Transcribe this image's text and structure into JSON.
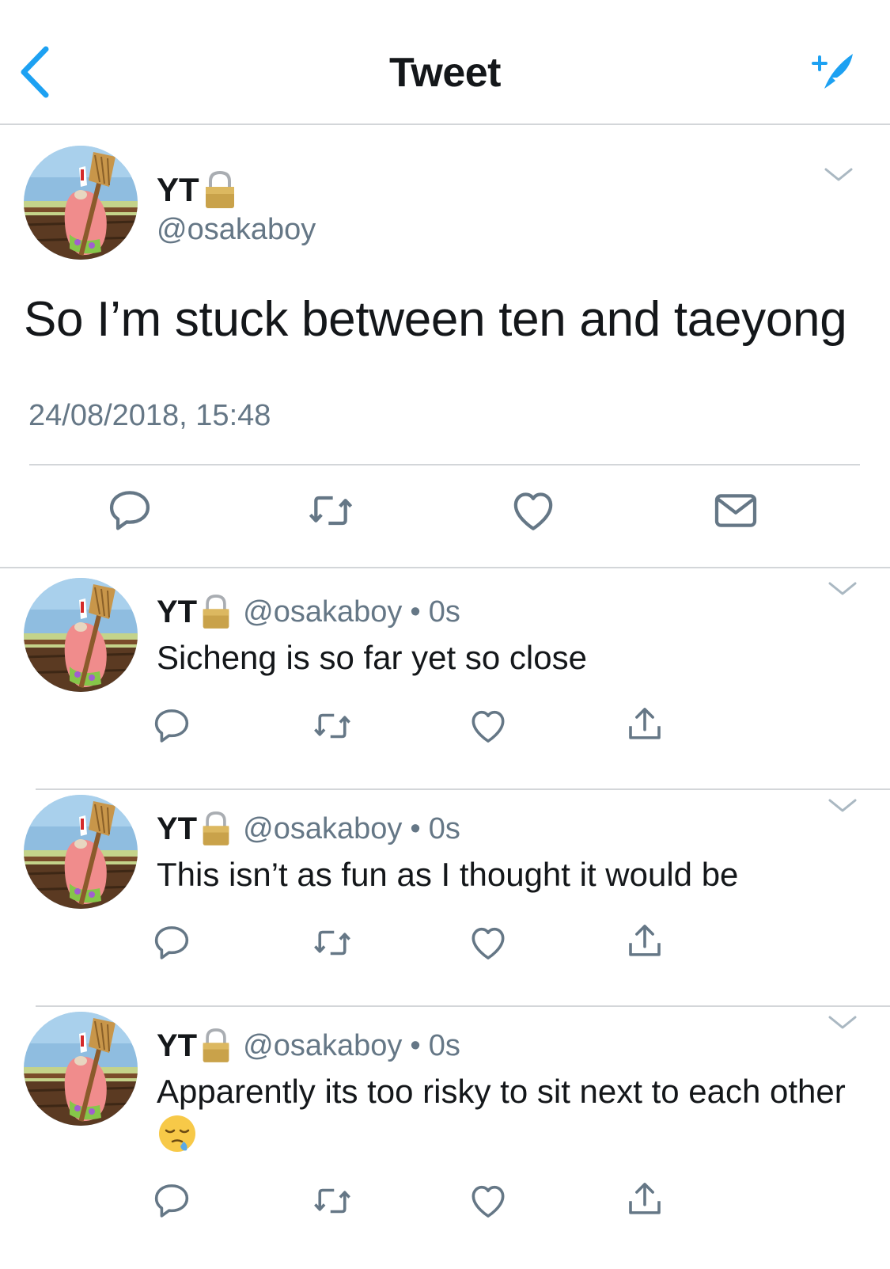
{
  "header": {
    "title": "Tweet",
    "back_icon": "chevron-left-icon",
    "compose_icon": "compose-feather-icon",
    "accent_color": "#1da1f2"
  },
  "main_tweet": {
    "name": "YT",
    "handle": "@osakaboy",
    "text": "So I’m stuck between ten and taeyong",
    "timestamp": "24/08/2018, 15:48",
    "actions": [
      "reply-icon",
      "retweet-icon",
      "like-icon",
      "message-icon"
    ]
  },
  "replies": [
    {
      "name": "YT",
      "handle": "@osakaboy",
      "separator": "•",
      "time": "0s",
      "text": "Sicheng is so far yet so close"
    },
    {
      "name": "YT",
      "handle": "@osakaboy",
      "separator": "•",
      "time": "0s",
      "text": "This isn’t as fun as I thought it would be"
    },
    {
      "name": "YT",
      "handle": "@osakaboy",
      "separator": "•",
      "time": "0s",
      "text": "Apparently its too risky to sit next to each other",
      "emoji": "sleepy-face-emoji"
    }
  ],
  "colors": {
    "text": "#14171a",
    "secondary": "#657786",
    "divider": "#d3d6d9",
    "icon": "#657786"
  }
}
